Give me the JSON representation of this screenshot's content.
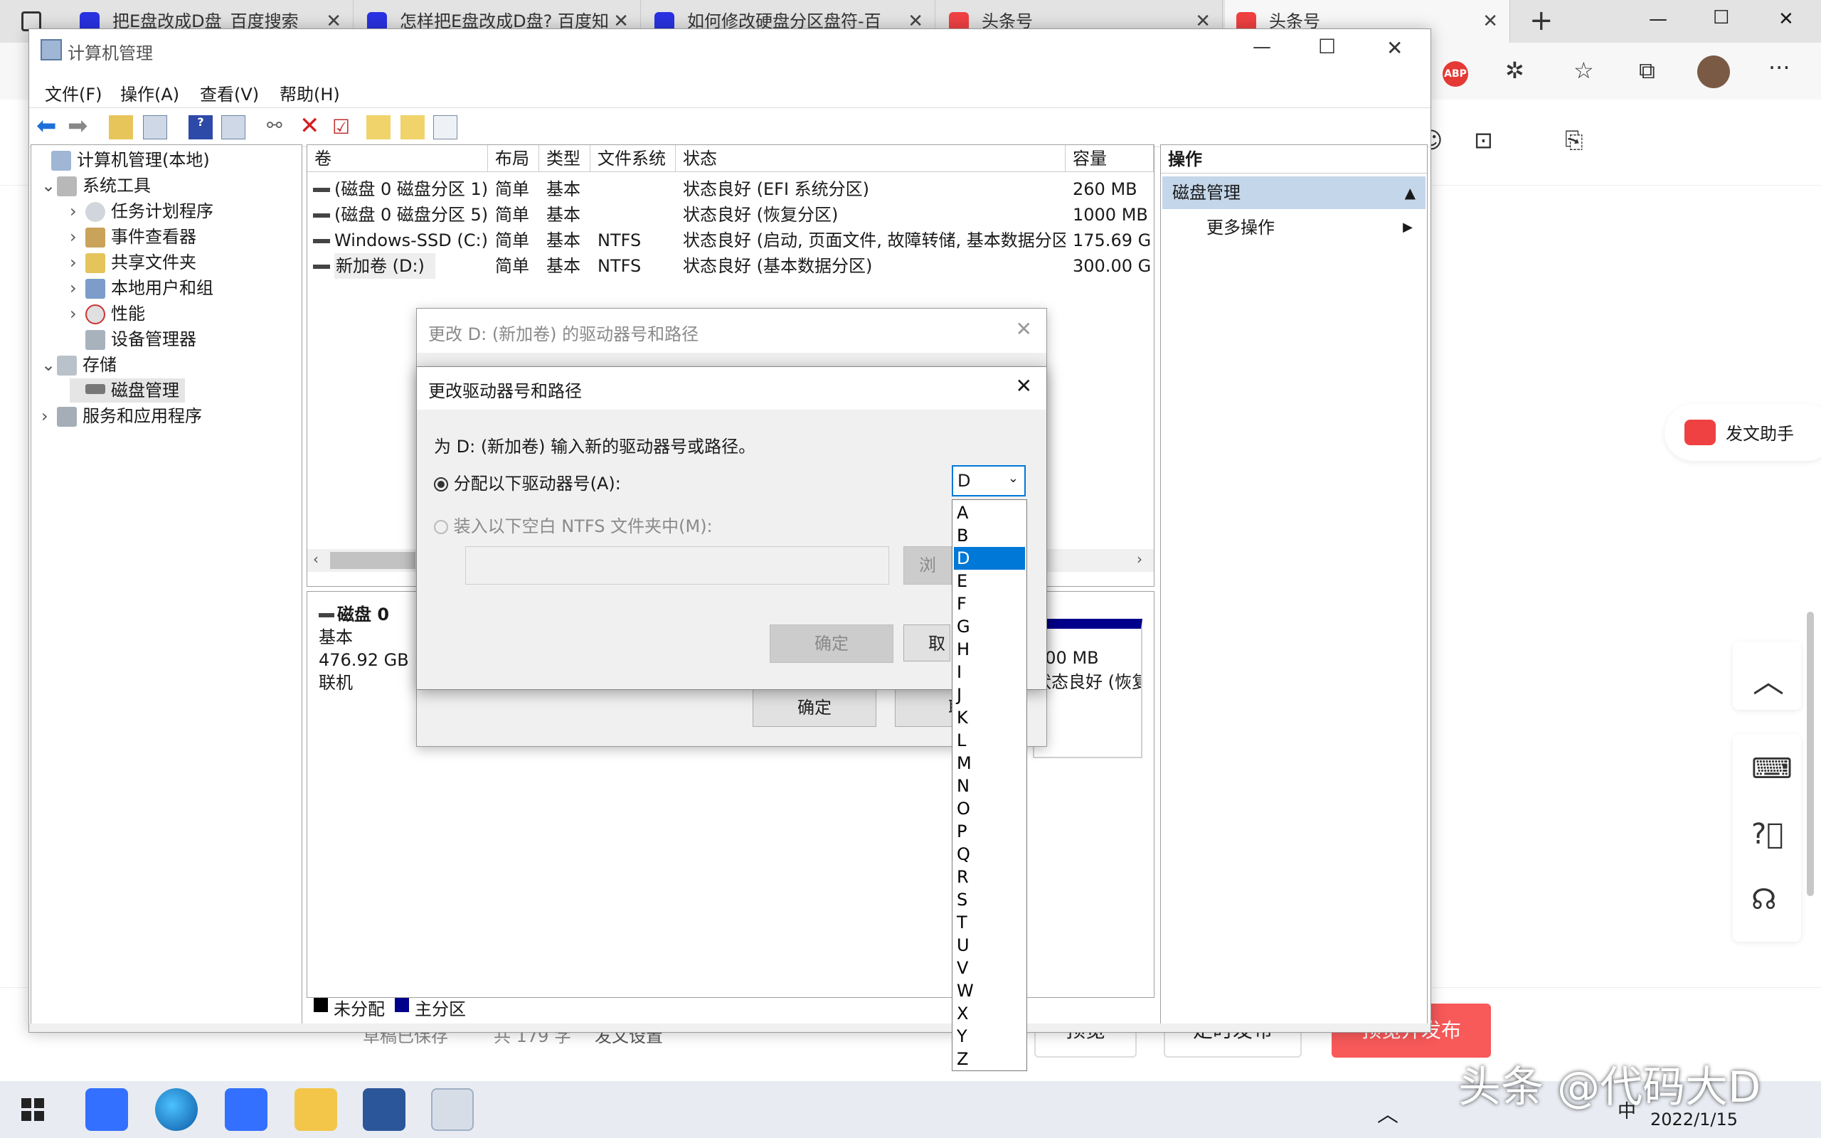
{
  "browser": {
    "tabs": [
      {
        "label": "把E盘改成D盘_百度搜索",
        "favicon_color": "#2932e1"
      },
      {
        "label": "怎样把E盘改成D盘? 百度知",
        "favicon_color": "#2932e1"
      },
      {
        "label": "如何修改硬盘分区盘符-百",
        "favicon_color": "#2932e1"
      },
      {
        "label": "头条号",
        "favicon_color": "#f04142"
      },
      {
        "label": "头条号",
        "favicon_color": "#f04142"
      }
    ],
    "new_tab_label": "+",
    "window_controls": {
      "minimize": "—",
      "maximize": "☐",
      "close": "✕"
    },
    "toolbar_icons": [
      "abp-icon",
      "extensions-icon",
      "favorites-icon",
      "collections-icon",
      "profile-avatar",
      "more-icon"
    ],
    "abp_label": "ABP",
    "more_label": "···"
  },
  "toutiao_page": {
    "assistant_label": "发文助手",
    "draft_status": "草稿已保存",
    "word_count": "共 179 字",
    "publish_settings": "发文设置",
    "preview_button": "预览",
    "schedule_button": "定时发布",
    "publish_button": "预览并发布",
    "accent": "#f04142"
  },
  "mmc": {
    "title": "计算机管理",
    "menu": [
      "文件(F)",
      "操作(A)",
      "查看(V)",
      "帮助(H)"
    ],
    "tree": [
      {
        "label": "计算机管理(本地)",
        "level": 0,
        "chev": ""
      },
      {
        "label": "系统工具",
        "level": 1,
        "chev": "⌄"
      },
      {
        "label": "任务计划程序",
        "level": 2,
        "chev": "›"
      },
      {
        "label": "事件查看器",
        "level": 2,
        "chev": "›"
      },
      {
        "label": "共享文件夹",
        "level": 2,
        "chev": "›"
      },
      {
        "label": "本地用户和组",
        "level": 2,
        "chev": "›"
      },
      {
        "label": "性能",
        "level": 2,
        "chev": "›"
      },
      {
        "label": "设备管理器",
        "level": 2,
        "chev": ""
      },
      {
        "label": "存储",
        "level": 1,
        "chev": "⌄"
      },
      {
        "label": "磁盘管理",
        "level": 2,
        "chev": ""
      },
      {
        "label": "服务和应用程序",
        "level": 1,
        "chev": "›"
      }
    ],
    "columns": [
      "卷",
      "布局",
      "类型",
      "文件系统",
      "状态",
      "容量"
    ],
    "volumes": [
      {
        "name": "(磁盘 0 磁盘分区 1)",
        "layout": "简单",
        "type": "基本",
        "fs": "",
        "status": "状态良好 (EFI 系统分区)",
        "capacity": "260 MB"
      },
      {
        "name": "(磁盘 0 磁盘分区 5)",
        "layout": "简单",
        "type": "基本",
        "fs": "",
        "status": "状态良好 (恢复分区)",
        "capacity": "1000 MB"
      },
      {
        "name": "Windows-SSD (C:)",
        "layout": "简单",
        "type": "基本",
        "fs": "NTFS",
        "status": "状态良好 (启动, 页面文件, 故障转储, 基本数据分区)",
        "capacity": "175.69 G"
      },
      {
        "name": "新加卷 (D:)",
        "layout": "简单",
        "type": "基本",
        "fs": "NTFS",
        "status": "状态良好 (基本数据分区)",
        "capacity": "300.00 G"
      }
    ],
    "disk": {
      "name": "磁盘 0",
      "kind": "基本",
      "size": "476.92 GB",
      "state": "联机"
    },
    "partition_right": {
      "size": "000 MB",
      "status": "状态良好 (恢复"
    },
    "legend": {
      "unallocated": "未分配",
      "primary": "主分区"
    },
    "actions": {
      "header": "操作",
      "section": "磁盘管理",
      "more": "更多操作"
    }
  },
  "dialog_back": {
    "title": "更改 D: (新加卷) 的驱动器号和路径",
    "ok": "确定",
    "cancel": "取"
  },
  "dialog": {
    "title": "更改驱动器号和路径",
    "prompt": "为 D: (新加卷) 输入新的驱动器号或路径。",
    "option_assign": "分配以下驱动器号(A):",
    "option_mount": "装入以下空白 NTFS 文件夹中(M):",
    "browse": "浏",
    "ok": "确定",
    "cancel": "取",
    "selected_letter": "D",
    "letters": [
      "A",
      "B",
      "D",
      "E",
      "F",
      "G",
      "H",
      "I",
      "J",
      "K",
      "L",
      "M",
      "N",
      "O",
      "P",
      "Q",
      "R",
      "S",
      "T",
      "U",
      "V",
      "W",
      "X",
      "Y",
      "Z"
    ]
  },
  "taskbar": {
    "date": "2022/1/15",
    "ime": "中"
  },
  "watermark": "头条 @代码大D"
}
